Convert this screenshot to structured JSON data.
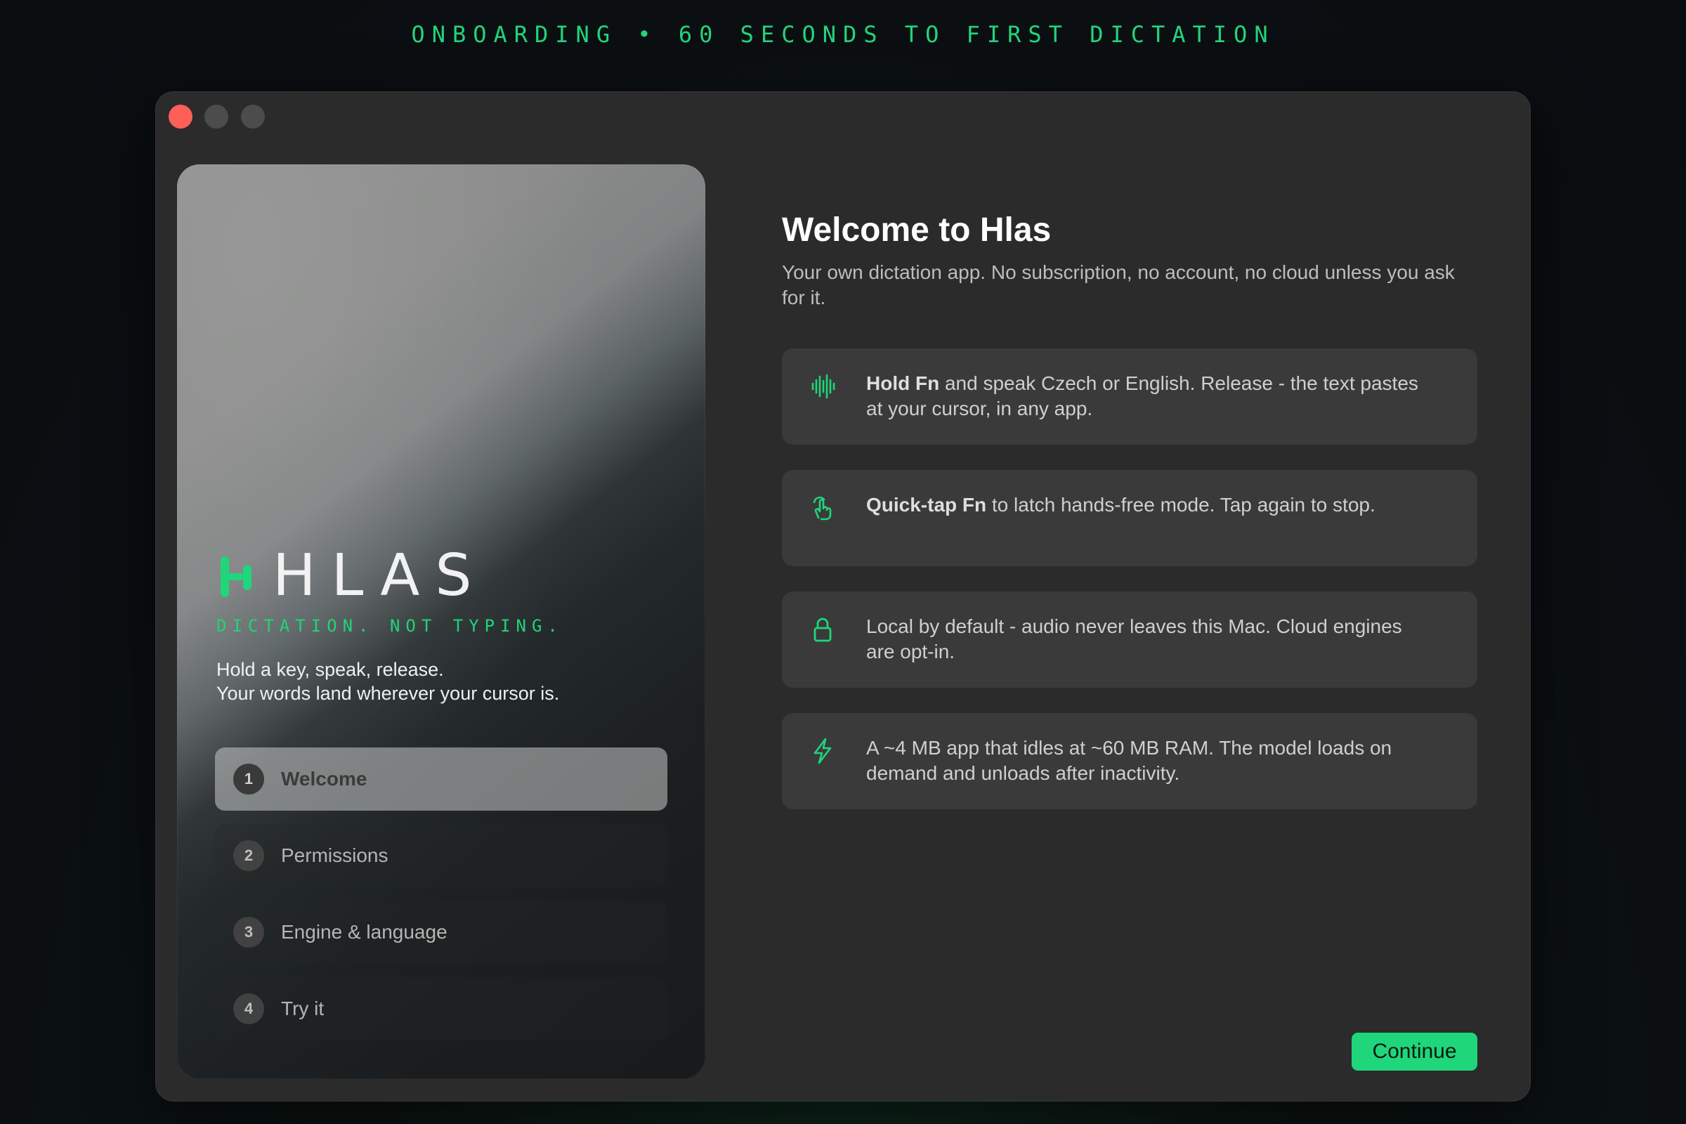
{
  "page": {
    "caption": "ONBOARDING • 60 SECONDS TO FIRST DICTATION"
  },
  "hero": {
    "wordmark": "HLAS",
    "tagline": "DICTATION. NOT TYPING.",
    "desc_line1": "Hold a key, speak, release.",
    "desc_line2": "Your words land wherever your cursor is."
  },
  "steps": [
    {
      "num": "1",
      "label": "Welcome",
      "active": true
    },
    {
      "num": "2",
      "label": "Permissions",
      "active": false
    },
    {
      "num": "3",
      "label": "Engine & language",
      "active": false
    },
    {
      "num": "4",
      "label": "Try it",
      "active": false
    }
  ],
  "main": {
    "title": "Welcome to Hlas",
    "subtitle": "Your own dictation app. No subscription, no account, no cloud unless you ask for it."
  },
  "features": [
    {
      "icon": "waveform-icon",
      "bold": "Hold Fn",
      "text": " and speak Czech or English. Release - the text pastes at your cursor, in any app."
    },
    {
      "icon": "tap-hand-icon",
      "bold": "Quick-tap Fn",
      "text": " to latch hands-free mode. Tap again to stop."
    },
    {
      "icon": "lock-icon",
      "bold": "",
      "text": "Local by default - audio never leaves this Mac. Cloud engines are opt-in."
    },
    {
      "icon": "lightning-icon",
      "bold": "",
      "text": "A ~4 MB app that idles at ~60 MB RAM. The model loads on demand and unloads after inactivity."
    }
  ],
  "actions": {
    "continue_label": "Continue"
  },
  "colors": {
    "accent": "#1fd67b",
    "close": "#fe5f57"
  }
}
